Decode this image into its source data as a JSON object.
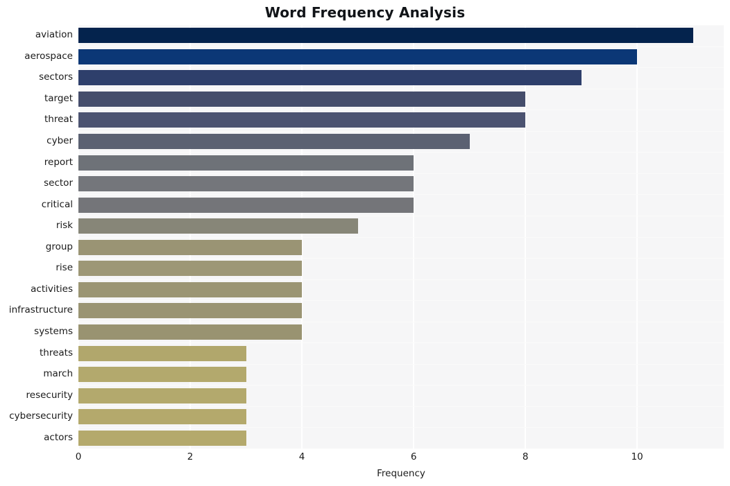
{
  "chart_data": {
    "type": "bar",
    "orientation": "horizontal",
    "title": "Word Frequency Analysis",
    "xlabel": "Frequency",
    "ylabel": "",
    "xlim": [
      0,
      11.55
    ],
    "xticks": [
      0,
      2,
      4,
      6,
      8,
      10
    ],
    "xtick_labels": [
      "0",
      "2",
      "4",
      "6",
      "8",
      "10"
    ],
    "grid": true,
    "grid_axis": "x",
    "legend": "none",
    "categories": [
      "aviation",
      "aerospace",
      "sectors",
      "target",
      "threat",
      "cyber",
      "report",
      "sector",
      "critical",
      "risk",
      "group",
      "rise",
      "activities",
      "infrastructure",
      "systems",
      "threats",
      "march",
      "resecurity",
      "cybersecurity",
      "actors"
    ],
    "values": [
      11,
      10,
      9,
      8,
      8,
      7,
      6,
      6,
      6,
      5,
      4,
      4,
      4,
      4,
      4,
      3,
      3,
      3,
      3,
      3
    ],
    "bar_colors": [
      "#04234d",
      "#0b3776",
      "#2e3f6b",
      "#454d6b",
      "#4c5371",
      "#5b6172",
      "#6e7278",
      "#74767b",
      "#747579",
      "#878678",
      "#9a9474",
      "#9d9776",
      "#9b9573",
      "#9a9473",
      "#999371",
      "#b1a76c",
      "#b3a96d",
      "#b3a96d",
      "#b4a96c",
      "#b4a96c"
    ],
    "plot_background": "#f6f6f7",
    "grid_color": "#ffffff",
    "figure_background": "#ffffff",
    "text_color": "#1a1a1a"
  }
}
